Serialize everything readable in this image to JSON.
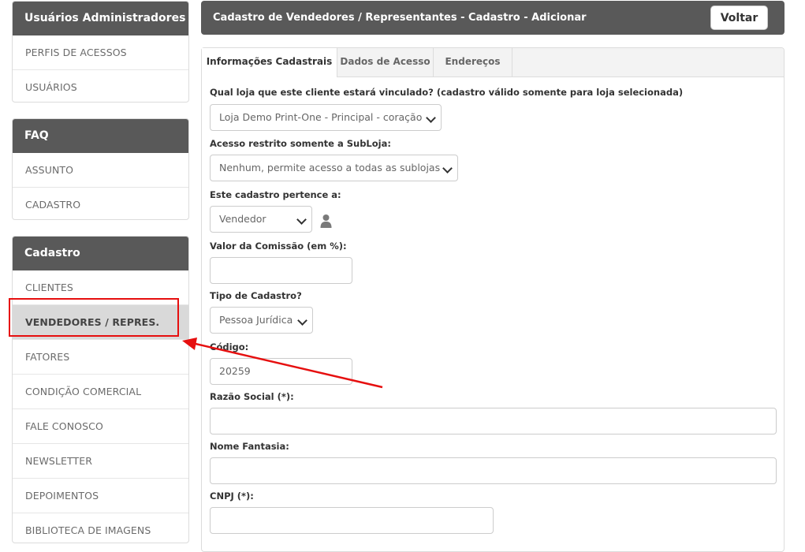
{
  "sidebar": {
    "sections": [
      {
        "title": "Usuários Administradores",
        "items": [
          "PERFIS DE ACESSOS",
          "USUÁRIOS"
        ]
      },
      {
        "title": "FAQ",
        "items": [
          "ASSUNTO",
          "CADASTRO"
        ]
      },
      {
        "title": "Cadastro",
        "items": [
          "CLIENTES",
          "VENDEDORES / REPRES.",
          "FATORES",
          "CONDIÇÃO COMERCIAL",
          "FALE CONOSCO",
          "NEWSLETTER",
          "DEPOIMENTOS",
          "BIBLIOTECA DE IMAGENS"
        ]
      }
    ],
    "active_item": "VENDEDORES / REPRES."
  },
  "header": {
    "title": "Cadastro de Vendedores / Representantes - Cadastro - Adicionar",
    "back_label": "Voltar"
  },
  "tabs": [
    "Informações Cadastrais",
    "Dados de Acesso",
    "Endereços"
  ],
  "active_tab": "Informações Cadastrais",
  "form": {
    "store_label": "Qual loja que este cliente estará vinculado? (cadastro válido somente para loja selecionada)",
    "store_value": "Loja Demo Print-One - Principal - coração",
    "subloja_label": "Acesso restrito somente a SubLoja:",
    "subloja_value": "Nenhum, permite acesso a todas as sublojas",
    "belongs_label": "Este cadastro pertence a:",
    "belongs_value": "Vendedor",
    "commission_label": "Valor da Comissão (em %):",
    "commission_value": "",
    "type_label": "Tipo de Cadastro?",
    "type_value": "Pessoa Jurídica",
    "code_label": "Código:",
    "code_value": "20259",
    "razao_label": "Razão Social (*):",
    "razao_value": "",
    "fantasia_label": "Nome Fantasia:",
    "fantasia_value": "",
    "cnpj_label": "CNPJ (*):",
    "cnpj_value": ""
  },
  "colors": {
    "header_bg": "#595959",
    "annotation_red": "#e60f0f",
    "active_item_bg": "#d9d9d9"
  },
  "icons": [
    "person-icon",
    "chevron-down-icon"
  ]
}
